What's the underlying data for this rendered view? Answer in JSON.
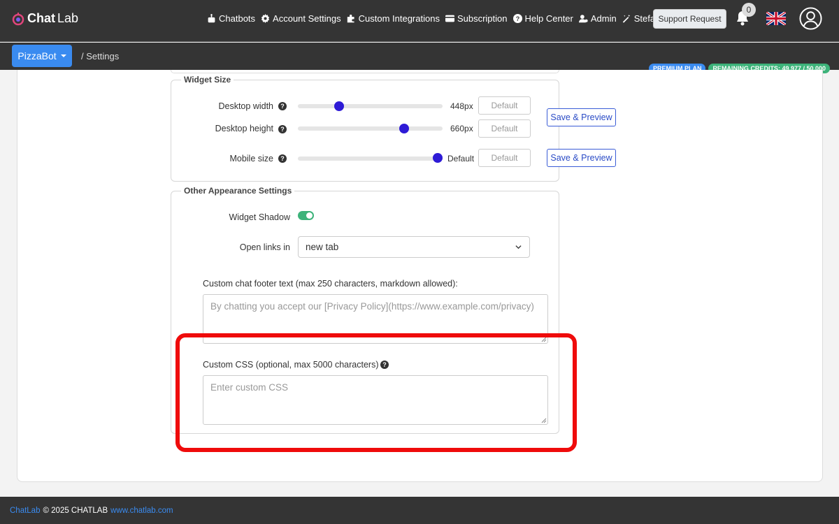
{
  "app": {
    "logo_bold": "Chat",
    "logo_light": "Lab"
  },
  "nav": {
    "items": [
      {
        "label": "Chatbots",
        "icon": "robot-icon"
      },
      {
        "label": "Account Settings",
        "icon": "gear-icon"
      },
      {
        "label": "Custom Integrations",
        "icon": "puzzle-icon"
      },
      {
        "label": "Subscription",
        "icon": "credit-card-icon"
      },
      {
        "label": "Help Center",
        "icon": "question-circle-icon"
      },
      {
        "label": "Admin",
        "icon": "user-gear-icon"
      },
      {
        "label": "Stefan AI",
        "icon": "magic-wand-icon"
      }
    ],
    "support_label": "Support Request",
    "notification_count": "0"
  },
  "subnav": {
    "bot_name": "PizzaBot",
    "breadcrumb": "/  Settings",
    "plan_badge": "PREMIUM PLAN",
    "credits_badge": "REMAINING CREDITS: 49,977 / 50,000"
  },
  "widget_size": {
    "legend": "Widget Size",
    "rows": [
      {
        "label": "Desktop width",
        "value": "448px",
        "default_label": "Default",
        "slider_fraction": 0.27
      },
      {
        "label": "Desktop height",
        "value": "660px",
        "default_label": "Default",
        "slider_fraction": 0.75
      },
      {
        "label": "Mobile size",
        "value": "Default",
        "default_label": "Default",
        "slider_fraction": 1.0
      }
    ],
    "save_label": "Save & Preview"
  },
  "other": {
    "legend": "Other Appearance Settings",
    "shadow_label": "Widget Shadow",
    "shadow_on": true,
    "links_label": "Open links in",
    "links_value": "new tab",
    "footer_label": "Custom chat footer text (max 250 characters, markdown allowed):",
    "footer_placeholder": "By chatting you accept our [Privacy Policy](https://www.example.com/privacy)",
    "css_label": "Custom CSS (optional, max 5000 characters)",
    "css_placeholder": "Enter custom CSS"
  },
  "footer": {
    "brand": "ChatLab",
    "copyright": "© 2025 CHATLAB",
    "url": "www.chatlab.com"
  },
  "colors": {
    "accent": "#3a8bf0",
    "success": "#3db37a",
    "slider": "#2e1bd6",
    "highlight": "#ef0b0b",
    "nav_bg": "#343434"
  }
}
